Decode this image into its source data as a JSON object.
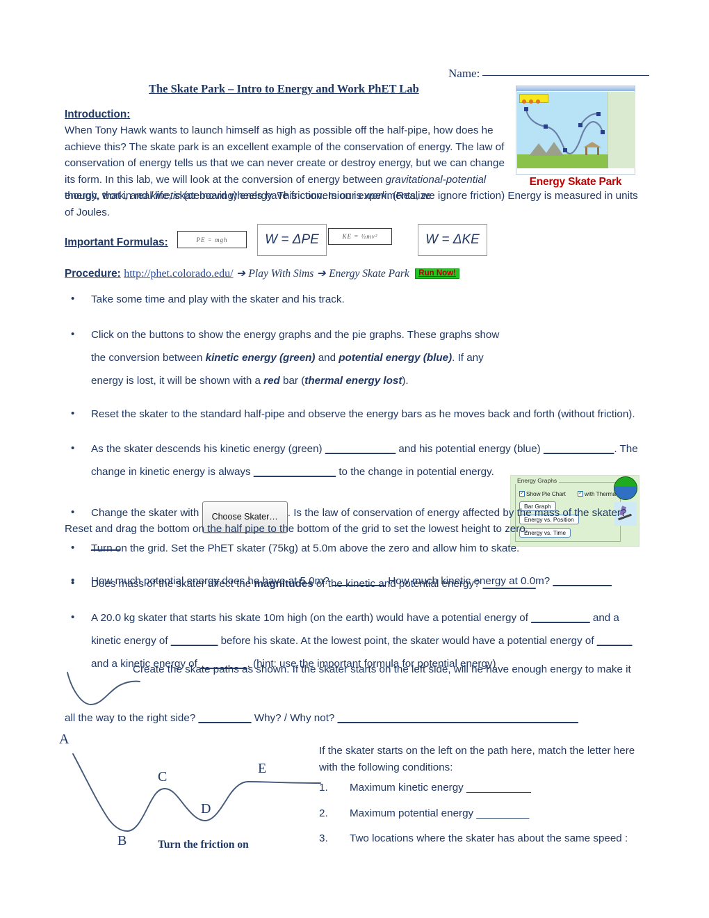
{
  "header": {
    "name_label": "Name:",
    "title": "The Skate Park – Intro to Energy and Work PhET Lab"
  },
  "intro": {
    "heading": "Introduction:",
    "para1": "When Tony Hawk wants to launch himself as high as possible off the half-pipe, how does he achieve this?  The skate park is an excellent example of the conservation of energy.  The law of conservation of energy tells us that we can never create or destroy energy, but we can change its form.  In this lab, we will look at the conversion of energy between ",
    "ital1": "gravitational-potential",
    "para1b": " energy, work, and ",
    "ital2": "kinetic",
    "para1c": " (or moving) energy.  This conversion is ",
    "ital3": "work",
    "para1d": ".  (Realize",
    "para2": "though, that in real life, skateboard wheels have friction.  In our experiments, we ignore friction) Energy is measured in units of Joules."
  },
  "phet_image": {
    "caption": "Energy Skate Park",
    "alt": "energy-skate-park-simulation-screenshot"
  },
  "formulas": {
    "label": "Important Formulas:",
    "pe": "PE = mgh",
    "w_pe": "W = ΔPE",
    "ke": "KE = ½mv²",
    "w_ke": "W = ΔKE"
  },
  "procedure": {
    "label": "Procedure:",
    "url": "http://phet.colorado.edu/",
    "arrow1": "➔",
    "step1": "Play With Sims",
    "arrow2": "➔",
    "step2": "Energy Skate Park",
    "run_now": "Run Now!"
  },
  "energy_graphs_panel": {
    "legend": "Energy Graphs",
    "check1": "Show Pie Chart",
    "check2": "with Therma",
    "btn1": "Bar Graph",
    "btn2": "Energy vs. Position",
    "btn3": "Energy vs. Time"
  },
  "bullets": [
    {
      "id": "play-with-skater",
      "text": "Take some time and play with the skater and his track."
    },
    {
      "id": "show-energy-graphs",
      "a": "Click on the buttons to show the energy graphs and the pie graphs.  These graphs show the conversion between ",
      "b": "kinetic energy (green)",
      "c": " and ",
      "d": "potential energy (blue)",
      "e": ".  If any energy is lost, it will be shown with a ",
      "f": "red",
      "g": " bar (",
      "h": "thermal energy lost",
      "i": ")."
    },
    {
      "id": "reset-half-pipe",
      "text": "Reset the skater to the standard half-pipe and observe the energy bars as he moves back and forth (without friction)."
    },
    {
      "id": "skater-descends",
      "a": "As the skater descends his kinetic energy (green) ",
      "blank1": "____________",
      "b": " and his potential energy (blue) ",
      "blank2": "____________",
      "c": ".  The change in kinetic energy is always ",
      "blank3": "______________",
      "d": " to the change in potential energy."
    },
    {
      "id": "change-skater",
      "a": "Change the skater with",
      "button": "Choose Skater…",
      "b": ".  Is the law of conservation of energy affected by the mass of the skater?",
      "blank": "_____"
    },
    {
      "id": "mass-magnitudes",
      "a": "Does mass of the skater affect the ",
      "b": "magnitudes",
      "c": " of the kinetic and potential energy? ",
      "blank": "_________"
    }
  ],
  "reset_section": {
    "lead": "Reset and drag the bottom on the half pipe to the bottom of the grid to set the lowest height to zero.",
    "bullets": [
      {
        "id": "turn-on-grid",
        "text": "Turn on the grid.  Set the PhET skater (75kg) at 5.0m above the zero and allow him to skate."
      },
      {
        "id": "pe-at-5m",
        "a": "How much potential energy does he have at 5.0m? ",
        "blank1": "_________",
        "b": "  How much kinetic energy at 0.0m? ",
        "blank2": "__________"
      },
      {
        "id": "twenty-kg-skater",
        "a": "A 20.0 kg skater that starts his skate 10m high (on the earth) would have a potential energy of ",
        "blank1": "__________",
        "b": " and a kinetic energy of ",
        "blank2": "________",
        "c": " before his skate.  At the lowest point, the skater would have a potential energy of ",
        "blank3": "______",
        "d": " and a kinetic energy of ",
        "blank4": "________",
        "e": ". (hint: use the important formula for potential energy)"
      }
    ]
  },
  "create_paths": {
    "text": "Create the skate paths as shown.  If the skater starts on the left side, will he have enough energy to make it",
    "line2a": "all the way to the right side? ",
    "blank1": "_________",
    "line2b": "  Why? / Why not? ",
    "blank2": "_________________________________________"
  },
  "path_diagram": {
    "letters": [
      "A",
      "B",
      "C",
      "D",
      "E"
    ],
    "friction_note": "Turn the friction on"
  },
  "right_questions": {
    "lead": "If the skater starts on the left on the path here, match the letter here with the following conditions:",
    "items": [
      {
        "num": "1.",
        "text": "Maximum kinetic energy ___________"
      },
      {
        "num": "2.",
        "text": "Maximum potential energy _________"
      },
      {
        "num": "3.",
        "text": "Two locations where the skater has about the same speed :"
      }
    ]
  },
  "colors": {
    "text": "#1F3864",
    "link": "#2b4fa0",
    "caption_red": "#c00000",
    "run_now_bg": "#22c522",
    "curve": "#445a78"
  }
}
